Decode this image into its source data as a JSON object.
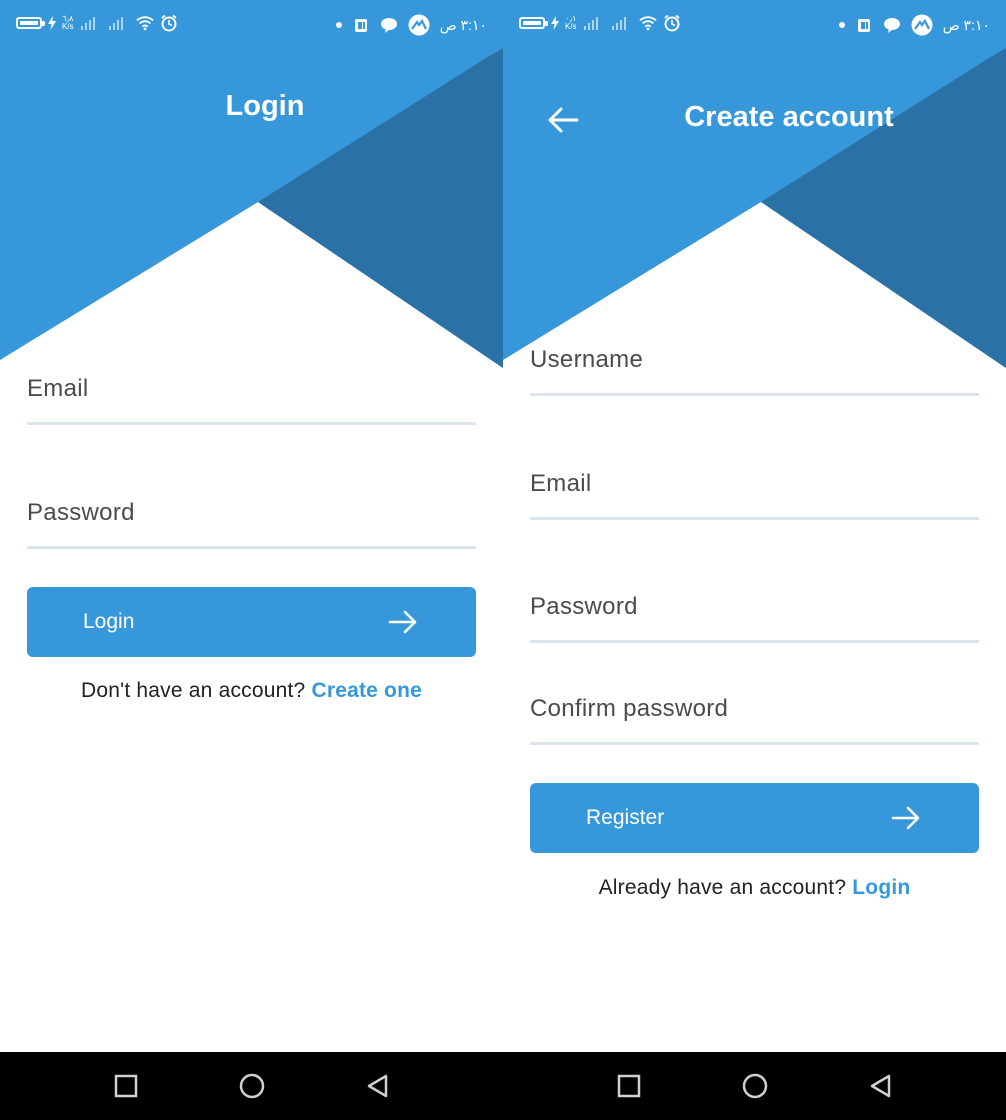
{
  "colors": {
    "accent": "#3698db",
    "accent_dark": "#2a72a6",
    "field_line": "#dbe3ee",
    "label": "#4b4b4b",
    "nav_bg": "#000000"
  },
  "status_bar": {
    "speed_value": "٦٫٨",
    "speed_value_right": "٠٫١",
    "speed_unit": "K/s",
    "time": "٣:١٠ ص"
  },
  "login": {
    "title": "Login",
    "fields": {
      "email": {
        "label": "Email"
      },
      "password": {
        "label": "Password"
      }
    },
    "button_label": "Login",
    "footer_prompt": "Don't have an account?",
    "footer_link": "Create one"
  },
  "register": {
    "title": "Create account",
    "fields": {
      "username": {
        "label": "Username"
      },
      "email": {
        "label": "Email"
      },
      "password": {
        "label": "Password"
      },
      "confirm_password": {
        "label": "Confirm password"
      }
    },
    "button_label": "Register",
    "footer_prompt": "Already have an account?",
    "footer_link": "Login"
  },
  "icons": {
    "back": "arrow-left-icon",
    "button_arrow": "arrow-right-icon",
    "nav_recent": "square-icon",
    "nav_home": "circle-icon",
    "nav_back": "triangle-back-icon"
  }
}
